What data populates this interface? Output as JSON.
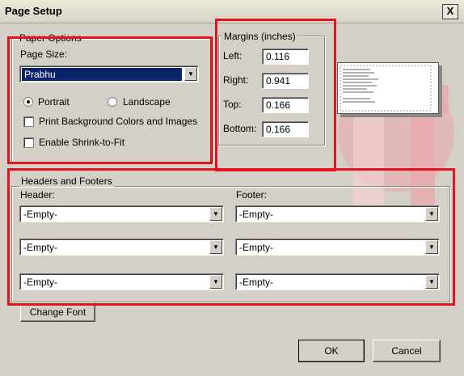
{
  "window": {
    "title": "Page Setup",
    "close_symbol": "X"
  },
  "paper_options": {
    "legend": "Paper Options",
    "page_size_label": "Page Size:",
    "page_size_value": "Prabhu",
    "portrait_label": "Portrait",
    "landscape_label": "Landscape",
    "orientation_selected": "Portrait",
    "print_bg_label": "Print Background Colors and Images",
    "print_bg_checked": false,
    "shrink_label": "Enable Shrink-to-Fit",
    "shrink_checked": false
  },
  "margins": {
    "legend": "Margins (inches)",
    "left_label": "Left:",
    "left_value": "0.116",
    "right_label": "Right:",
    "right_value": "0.941",
    "top_label": "Top:",
    "top_value": "0.166",
    "bottom_label": "Bottom:",
    "bottom_value": "0.166"
  },
  "headers_footers": {
    "legend": "Headers and Footers",
    "header_label": "Header:",
    "footer_label": "Footer:",
    "header_values": [
      "-Empty-",
      "-Empty-",
      "-Empty-"
    ],
    "footer_values": [
      "-Empty-",
      "-Empty-",
      "-Empty-"
    ],
    "change_font_label": "Change Font"
  },
  "buttons": {
    "ok_label": "OK",
    "cancel_label": "Cancel"
  },
  "colors": {
    "highlight_red": "#e0141e",
    "selection_blue": "#0a246a",
    "dialog_bg": "#d4d0c8"
  }
}
